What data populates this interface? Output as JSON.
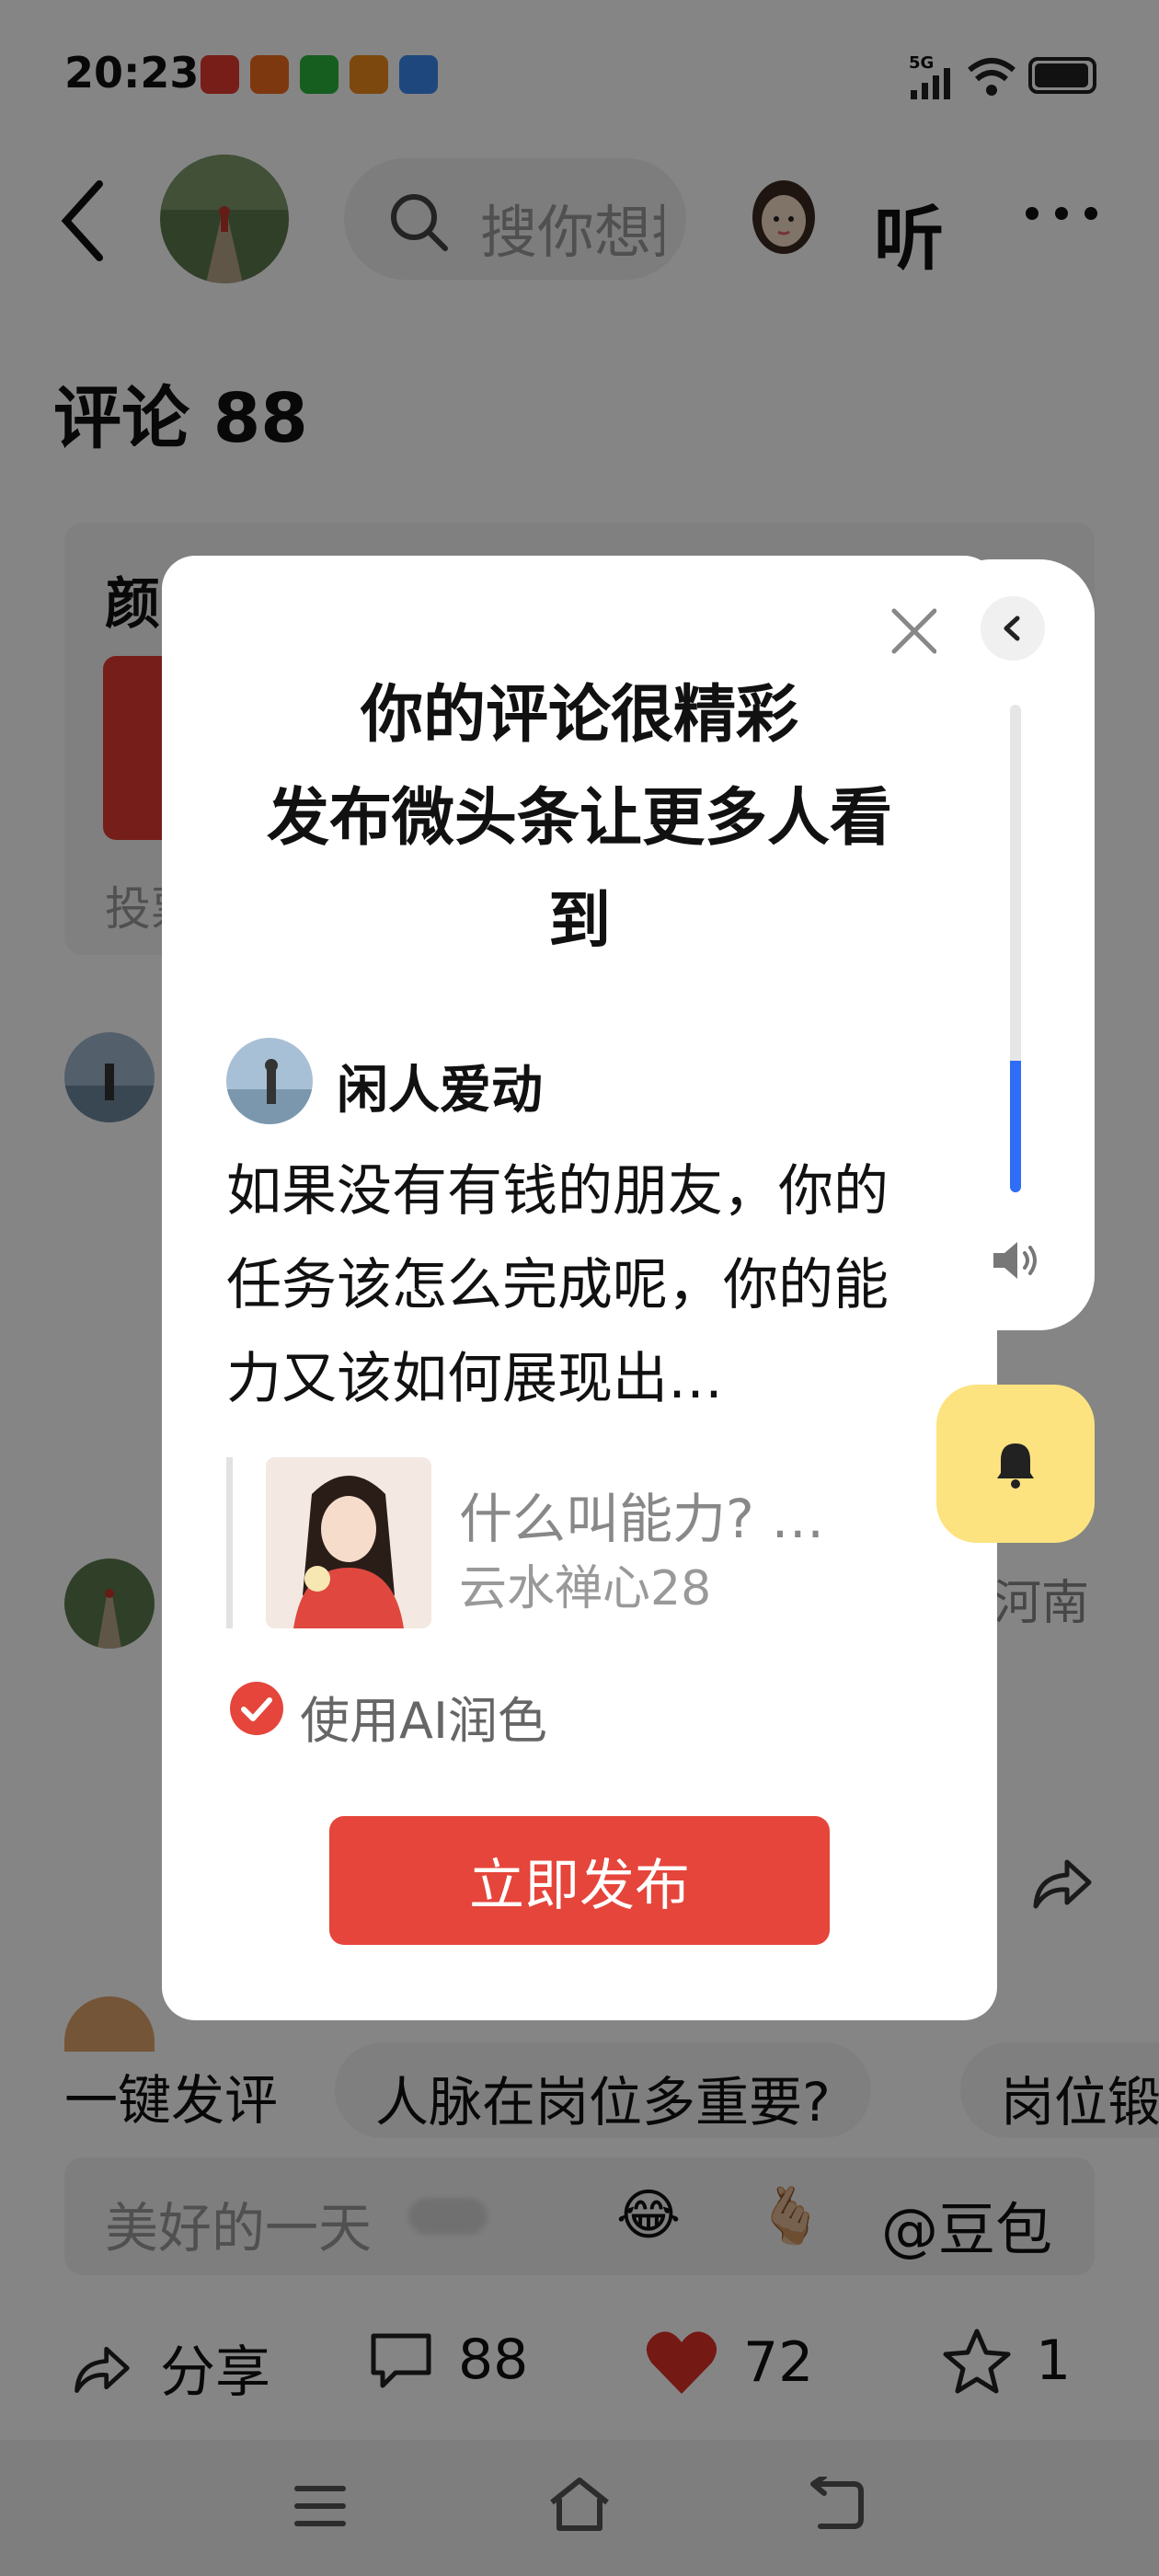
{
  "status_bar": {
    "time": "20:23",
    "network": "5G"
  },
  "header": {
    "search_placeholder": "搜你想搜",
    "listen_label": "听"
  },
  "comments": {
    "title": "评论 88"
  },
  "bg_card": {
    "title_char": "颜",
    "vote_text": "投票"
  },
  "bg_comment": {
    "location_snip": "河南"
  },
  "suggestions": {
    "label": "一键发评",
    "chips": [
      "人脉在岗位多重要?",
      "岗位锻"
    ]
  },
  "input": {
    "placeholder": "美好的一天",
    "mention": "@豆包",
    "emoji1": "😂",
    "emoji2": "🫰🏼"
  },
  "actions": {
    "share": "分享",
    "comments": "88",
    "likes": "72",
    "favorites": "1"
  },
  "modal": {
    "title_line1": "你的评论很精彩",
    "title_line2": "发布微头条让更多人看",
    "title_line3": "到",
    "author": "闲人爱动",
    "body": "如果没有有钱的朋友，你的任务该怎么完成呢，你的能力又该如何展现出…",
    "quote_title": "什么叫能力? …",
    "quote_author": "云水禅心28",
    "ai_label": "使用AI润色",
    "publish_label": "立即发布"
  },
  "volume": {
    "level": 0.27
  },
  "colors": {
    "accent_red": "#e5453b",
    "volume_blue": "#2f6df6",
    "bell_yellow": "#fde37f"
  }
}
